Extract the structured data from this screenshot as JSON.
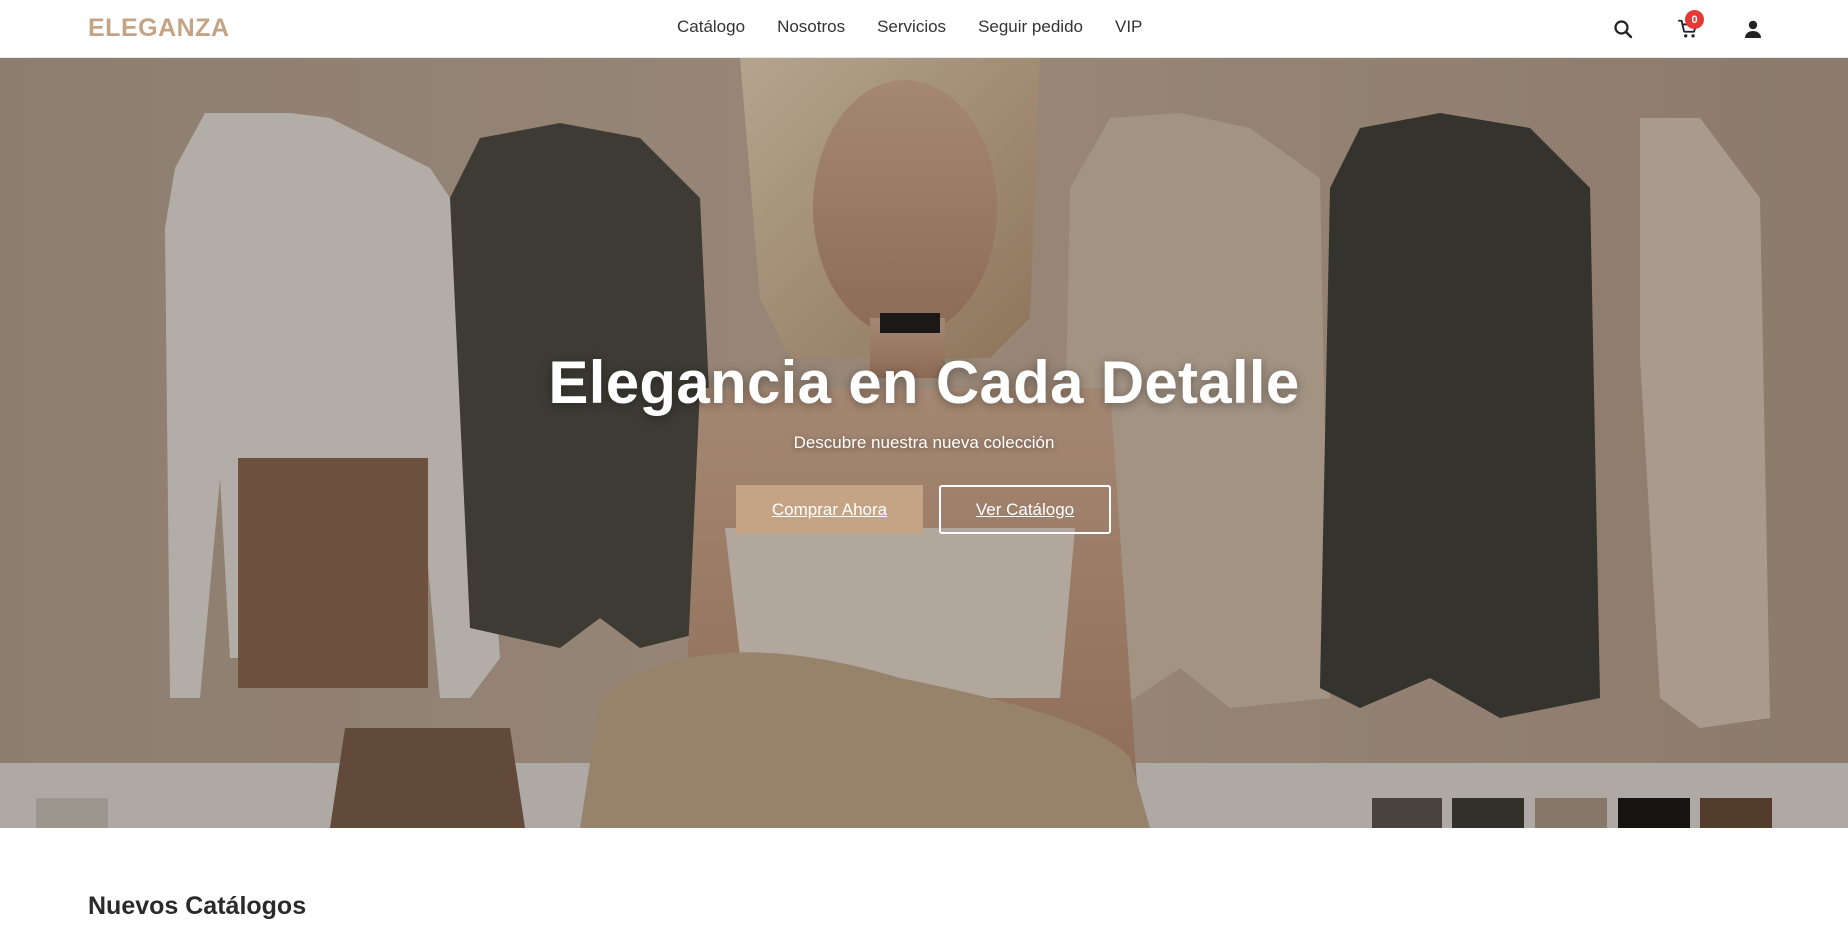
{
  "brand": {
    "name": "ELEGANZA",
    "color": "#c4a484"
  },
  "nav": {
    "items": [
      {
        "label": "Catálogo"
      },
      {
        "label": "Nosotros"
      },
      {
        "label": "Servicios"
      },
      {
        "label": "Seguir pedido"
      },
      {
        "label": "VIP"
      }
    ]
  },
  "header_icons": {
    "search": "search-icon",
    "cart": "cart-icon",
    "user": "user-icon",
    "cart_count": "0"
  },
  "hero": {
    "title": "Elegancia en Cada Detalle",
    "subtitle": "Descubre nuestra nueva colección",
    "primary_button": "Comprar Ahora",
    "secondary_button": "Ver Catálogo",
    "accent_color": "#c4a484"
  },
  "section": {
    "title": "Nuevos Catálogos"
  }
}
